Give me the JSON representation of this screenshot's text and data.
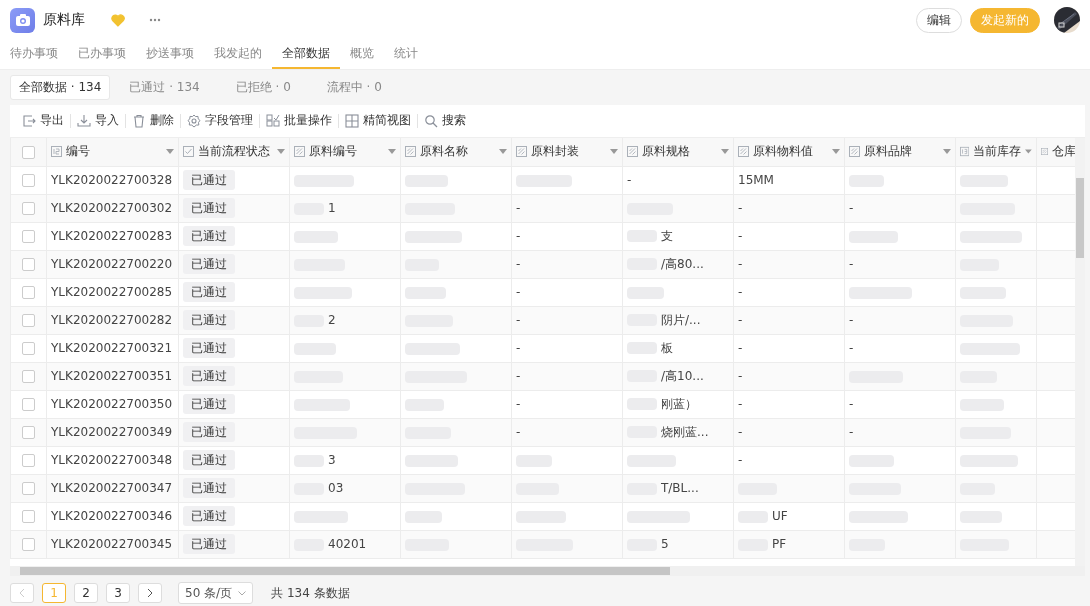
{
  "app": {
    "title": "原料库",
    "favorite": true
  },
  "actions": [
    {
      "label": "编辑",
      "kind": "outline"
    },
    {
      "label": "发起新的",
      "kind": "primary"
    }
  ],
  "tabs": [
    {
      "label": "待办事项",
      "selected": false
    },
    {
      "label": "已办事项",
      "selected": false
    },
    {
      "label": "抄送事项",
      "selected": false
    },
    {
      "label": "我发起的",
      "selected": false
    },
    {
      "label": "全部数据",
      "selected": true
    },
    {
      "label": "概览",
      "selected": false
    },
    {
      "label": "统计",
      "selected": false
    }
  ],
  "filters": [
    {
      "label": "全部数据 · 134",
      "selected": true
    },
    {
      "label": "已通过 · 134",
      "selected": false
    },
    {
      "label": "已拒绝 · 0",
      "selected": false
    },
    {
      "label": "流程中 · 0",
      "selected": false
    }
  ],
  "toolbar": [
    {
      "label": "导出",
      "kind": "export"
    },
    {
      "label": "导入",
      "kind": "import"
    },
    {
      "label": "删除",
      "kind": "delete"
    },
    {
      "label": "字段管理",
      "kind": "fields"
    },
    {
      "label": "批量操作",
      "kind": "batch"
    },
    {
      "label": "精简视图",
      "kind": "view"
    },
    {
      "label": "搜索",
      "kind": "search"
    }
  ],
  "table": {
    "all_checked": false,
    "columns": [
      {
        "label": "编号",
        "kind": "serial"
      },
      {
        "label": "当前流程状态",
        "kind": "status"
      },
      {
        "label": "原料编号",
        "kind": "text"
      },
      {
        "label": "原料名称",
        "kind": "text"
      },
      {
        "label": "原料封装",
        "kind": "text"
      },
      {
        "label": "原料规格",
        "kind": "text"
      },
      {
        "label": "原料物料值",
        "kind": "text"
      },
      {
        "label": "原料品牌",
        "kind": "text"
      },
      {
        "label": "当前库存",
        "kind": "number"
      },
      {
        "label": "仓库",
        "kind": "text"
      }
    ],
    "rows": [
      {
        "checked": false,
        "cells": [
          {
            "kind": "text",
            "text": "YLK2020022700328"
          },
          {
            "kind": "tag",
            "text": "已通过"
          },
          {
            "kind": "blur"
          },
          {
            "kind": "blur"
          },
          {
            "kind": "blur"
          },
          {
            "kind": "text",
            "text": "-"
          },
          {
            "kind": "text",
            "text": "15MM"
          },
          {
            "kind": "blur"
          },
          {
            "kind": "blur"
          },
          {
            "kind": "none"
          }
        ]
      },
      {
        "checked": false,
        "cells": [
          {
            "kind": "text",
            "text": "YLK2020022700302"
          },
          {
            "kind": "tag",
            "text": "已通过"
          },
          {
            "kind": "partial",
            "text": "1"
          },
          {
            "kind": "blur"
          },
          {
            "kind": "text",
            "text": "-"
          },
          {
            "kind": "blur"
          },
          {
            "kind": "text",
            "text": "-"
          },
          {
            "kind": "text",
            "text": "-"
          },
          {
            "kind": "blur"
          },
          {
            "kind": "none"
          }
        ]
      },
      {
        "checked": false,
        "cells": [
          {
            "kind": "text",
            "text": "YLK2020022700283"
          },
          {
            "kind": "tag",
            "text": "已通过"
          },
          {
            "kind": "blur"
          },
          {
            "kind": "blur"
          },
          {
            "kind": "text",
            "text": "-"
          },
          {
            "kind": "partial",
            "text": "支"
          },
          {
            "kind": "text",
            "text": "-"
          },
          {
            "kind": "blur"
          },
          {
            "kind": "blur"
          },
          {
            "kind": "none"
          }
        ]
      },
      {
        "checked": false,
        "cells": [
          {
            "kind": "text",
            "text": "YLK2020022700220"
          },
          {
            "kind": "tag",
            "text": "已通过"
          },
          {
            "kind": "blur"
          },
          {
            "kind": "blur"
          },
          {
            "kind": "text",
            "text": "-"
          },
          {
            "kind": "partial",
            "text": "/高80..."
          },
          {
            "kind": "text",
            "text": "-"
          },
          {
            "kind": "text",
            "text": "-"
          },
          {
            "kind": "blur"
          },
          {
            "kind": "none"
          }
        ]
      },
      {
        "checked": false,
        "cells": [
          {
            "kind": "text",
            "text": "YLK2020022700285"
          },
          {
            "kind": "tag",
            "text": "已通过"
          },
          {
            "kind": "blur"
          },
          {
            "kind": "blur"
          },
          {
            "kind": "text",
            "text": "-"
          },
          {
            "kind": "blur"
          },
          {
            "kind": "text",
            "text": "-"
          },
          {
            "kind": "blur"
          },
          {
            "kind": "blur"
          },
          {
            "kind": "none"
          }
        ]
      },
      {
        "checked": false,
        "cells": [
          {
            "kind": "text",
            "text": "YLK2020022700282"
          },
          {
            "kind": "tag",
            "text": "已通过"
          },
          {
            "kind": "partial",
            "text": "2"
          },
          {
            "kind": "blur"
          },
          {
            "kind": "text",
            "text": "-"
          },
          {
            "kind": "partial",
            "text": "阴片/..."
          },
          {
            "kind": "text",
            "text": "-"
          },
          {
            "kind": "text",
            "text": "-"
          },
          {
            "kind": "blur"
          },
          {
            "kind": "none"
          }
        ]
      },
      {
        "checked": false,
        "cells": [
          {
            "kind": "text",
            "text": "YLK2020022700321"
          },
          {
            "kind": "tag",
            "text": "已通过"
          },
          {
            "kind": "blur"
          },
          {
            "kind": "blur"
          },
          {
            "kind": "text",
            "text": "-"
          },
          {
            "kind": "partial",
            "text": "板"
          },
          {
            "kind": "text",
            "text": "-"
          },
          {
            "kind": "text",
            "text": "-"
          },
          {
            "kind": "blur"
          },
          {
            "kind": "none"
          }
        ]
      },
      {
        "checked": false,
        "cells": [
          {
            "kind": "text",
            "text": "YLK2020022700351"
          },
          {
            "kind": "tag",
            "text": "已通过"
          },
          {
            "kind": "blur"
          },
          {
            "kind": "blur"
          },
          {
            "kind": "text",
            "text": "-"
          },
          {
            "kind": "partial",
            "text": "/高10..."
          },
          {
            "kind": "text",
            "text": "-"
          },
          {
            "kind": "blur"
          },
          {
            "kind": "blur"
          },
          {
            "kind": "none"
          }
        ]
      },
      {
        "checked": false,
        "cells": [
          {
            "kind": "text",
            "text": "YLK2020022700350"
          },
          {
            "kind": "tag",
            "text": "已通过"
          },
          {
            "kind": "blur"
          },
          {
            "kind": "blur"
          },
          {
            "kind": "text",
            "text": "-"
          },
          {
            "kind": "partial",
            "text": "刚蓝）"
          },
          {
            "kind": "text",
            "text": "-"
          },
          {
            "kind": "text",
            "text": "-"
          },
          {
            "kind": "blur"
          },
          {
            "kind": "none"
          }
        ]
      },
      {
        "checked": false,
        "cells": [
          {
            "kind": "text",
            "text": "YLK2020022700349"
          },
          {
            "kind": "tag",
            "text": "已通过"
          },
          {
            "kind": "blur"
          },
          {
            "kind": "blur"
          },
          {
            "kind": "text",
            "text": "-"
          },
          {
            "kind": "partial",
            "text": "烧刚蓝..."
          },
          {
            "kind": "text",
            "text": "-"
          },
          {
            "kind": "text",
            "text": "-"
          },
          {
            "kind": "blur"
          },
          {
            "kind": "none"
          }
        ]
      },
      {
        "checked": false,
        "cells": [
          {
            "kind": "text",
            "text": "YLK2020022700348"
          },
          {
            "kind": "tag",
            "text": "已通过"
          },
          {
            "kind": "partial",
            "text": "3"
          },
          {
            "kind": "blur"
          },
          {
            "kind": "blur"
          },
          {
            "kind": "blur"
          },
          {
            "kind": "text",
            "text": "-"
          },
          {
            "kind": "blur"
          },
          {
            "kind": "blur"
          },
          {
            "kind": "none"
          }
        ]
      },
      {
        "checked": false,
        "cells": [
          {
            "kind": "text",
            "text": "YLK2020022700347"
          },
          {
            "kind": "tag",
            "text": "已通过"
          },
          {
            "kind": "partial",
            "text": "03"
          },
          {
            "kind": "blur"
          },
          {
            "kind": "blur"
          },
          {
            "kind": "partial",
            "text": "T/BL..."
          },
          {
            "kind": "blur"
          },
          {
            "kind": "blur"
          },
          {
            "kind": "blur"
          },
          {
            "kind": "none"
          }
        ]
      },
      {
        "checked": false,
        "cells": [
          {
            "kind": "text",
            "text": "YLK2020022700346"
          },
          {
            "kind": "tag",
            "text": "已通过"
          },
          {
            "kind": "blur"
          },
          {
            "kind": "blur"
          },
          {
            "kind": "blur"
          },
          {
            "kind": "blur"
          },
          {
            "kind": "partial",
            "text": "UF"
          },
          {
            "kind": "blur"
          },
          {
            "kind": "blur"
          },
          {
            "kind": "none"
          }
        ]
      },
      {
        "checked": false,
        "cells": [
          {
            "kind": "text",
            "text": "YLK2020022700345"
          },
          {
            "kind": "tag",
            "text": "已通过"
          },
          {
            "kind": "partial",
            "text": "40201"
          },
          {
            "kind": "blur"
          },
          {
            "kind": "blur"
          },
          {
            "kind": "partial",
            "text": "5"
          },
          {
            "kind": "partial",
            "text": "PF"
          },
          {
            "kind": "blur"
          },
          {
            "kind": "blur"
          },
          {
            "kind": "none"
          }
        ]
      }
    ]
  },
  "pagination": {
    "prev_disabled": true,
    "next_disabled": false,
    "pages": [
      {
        "label": "1",
        "selected": true
      },
      {
        "label": "2",
        "selected": false
      },
      {
        "label": "3",
        "selected": false
      }
    ],
    "page_size": "50 条/页",
    "total": "共 134 条数据"
  }
}
